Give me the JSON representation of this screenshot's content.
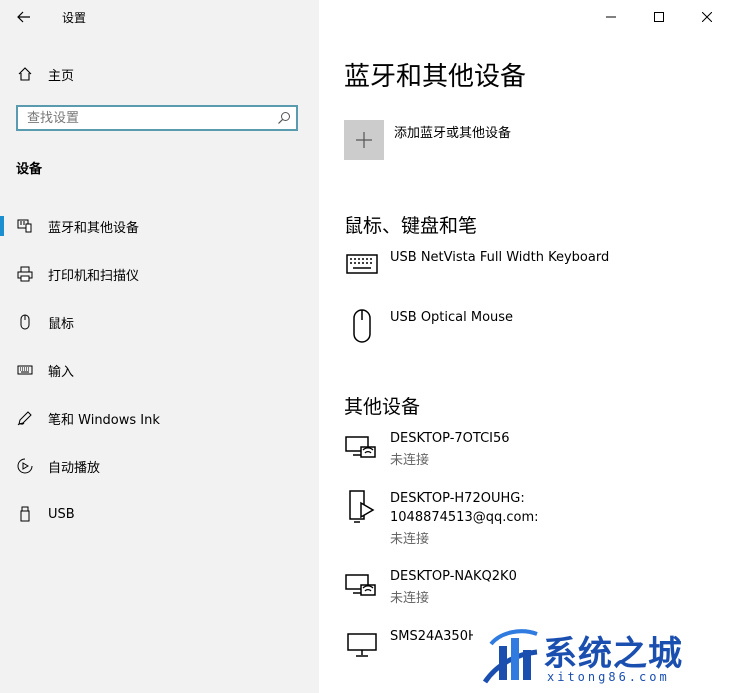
{
  "app": {
    "title": "设置"
  },
  "sidebar": {
    "home_label": "主页",
    "search_placeholder": "查找设置",
    "section_heading": "设备",
    "items": [
      {
        "label": "蓝牙和其他设备",
        "icon": "bluetooth-devices-icon",
        "active": true
      },
      {
        "label": "打印机和扫描仪",
        "icon": "printer-icon",
        "active": false
      },
      {
        "label": "鼠标",
        "icon": "mouse-icon",
        "active": false
      },
      {
        "label": "输入",
        "icon": "keyboard-icon",
        "active": false
      },
      {
        "label": "笔和 Windows Ink",
        "icon": "pen-icon",
        "active": false
      },
      {
        "label": "自动播放",
        "icon": "autoplay-icon",
        "active": false
      },
      {
        "label": "USB",
        "icon": "usb-icon",
        "active": false
      }
    ]
  },
  "main": {
    "title": "蓝牙和其他设备",
    "add_device_label": "添加蓝牙或其他设备",
    "groups": [
      {
        "heading": "鼠标、键盘和笔",
        "devices": [
          {
            "name": "USB NetVista Full Width Keyboard",
            "icon": "keyboard-icon"
          },
          {
            "name": "USB Optical Mouse",
            "icon": "mouse-icon"
          }
        ]
      },
      {
        "heading": "其他设备",
        "devices": [
          {
            "name": "DESKTOP-7OTCI56",
            "status": "未连接",
            "icon": "network-display-icon"
          },
          {
            "name_line1": "DESKTOP-H72OUHG:",
            "name_line2": "1048874513@qq.com:",
            "status": "未连接",
            "icon": "media-device-icon"
          },
          {
            "name": "DESKTOP-NAKQ2K0",
            "status": "未连接",
            "icon": "network-display-icon"
          },
          {
            "name": "SMS24A350H",
            "icon": "monitor-icon"
          }
        ]
      }
    ]
  },
  "watermark": {
    "text": "系统之城",
    "url": "xitong86.com"
  },
  "colors": {
    "accent": "#1b8fd0",
    "sidebar_bg": "#f2f2f2",
    "search_border": "#5b9bb0",
    "watermark": "#1a4fb0"
  }
}
